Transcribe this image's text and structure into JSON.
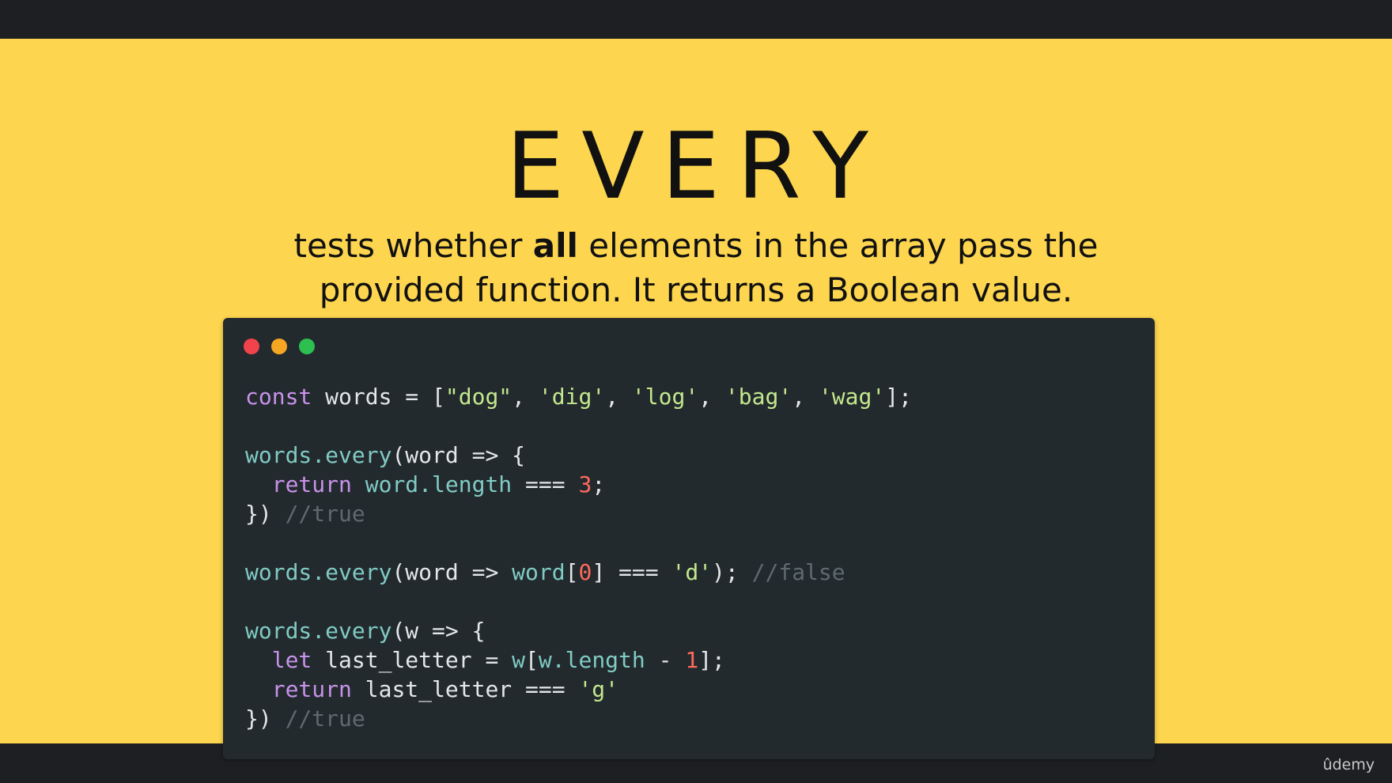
{
  "slide": {
    "title": "EVERY",
    "subtitle_line1_pre": "tests whether ",
    "subtitle_line1_bold": "all",
    "subtitle_line1_post": " elements in the array pass the",
    "subtitle_line2": "provided function. It returns a Boolean value."
  },
  "code": {
    "l1": {
      "kw": "const",
      "id": " words = [",
      "s1": "\"dog\"",
      "c1": ", ",
      "s2": "'dig'",
      "c2": ", ",
      "s3": "'log'",
      "c3": ", ",
      "s4": "'bag'",
      "c4": ", ",
      "s5": "'wag'",
      "end": "];"
    },
    "l3": {
      "fn1": "words.every",
      "rest": "(word => {"
    },
    "l4": {
      "indent": "  ",
      "kw": "return",
      "sp": " ",
      "fn": "word.length",
      "op": " === ",
      "num": "3",
      "end": ";"
    },
    "l5": {
      "close": "}) ",
      "cm": "//true"
    },
    "l7": {
      "fn1": "words.every",
      "p1": "(word => ",
      "fn2": "word",
      "p2": "[",
      "num": "0",
      "p3": "] === ",
      "str": "'d'",
      "p4": "); ",
      "cm": "//false"
    },
    "l9": {
      "fn1": "words.every",
      "rest": "(w => {"
    },
    "l10": {
      "indent": "  ",
      "kw": "let",
      "id": " last_letter = ",
      "fn": "w",
      "p1": "[",
      "fn2": "w.length",
      "p2": " - ",
      "num": "1",
      "end": "];"
    },
    "l11": {
      "indent": "  ",
      "kw": "return",
      "id": " last_letter === ",
      "str": "'g'"
    },
    "l12": {
      "close": "}) ",
      "cm": "//true"
    }
  },
  "footer": {
    "brand": "ûdemy"
  },
  "colors": {
    "slide_background": "#fdd54f",
    "code_background": "#232a2e",
    "keyword": "#c792ea",
    "function": "#80cbc4",
    "string": "#c3e88d",
    "number": "#ff6a5c",
    "comment": "#5d6a70"
  }
}
